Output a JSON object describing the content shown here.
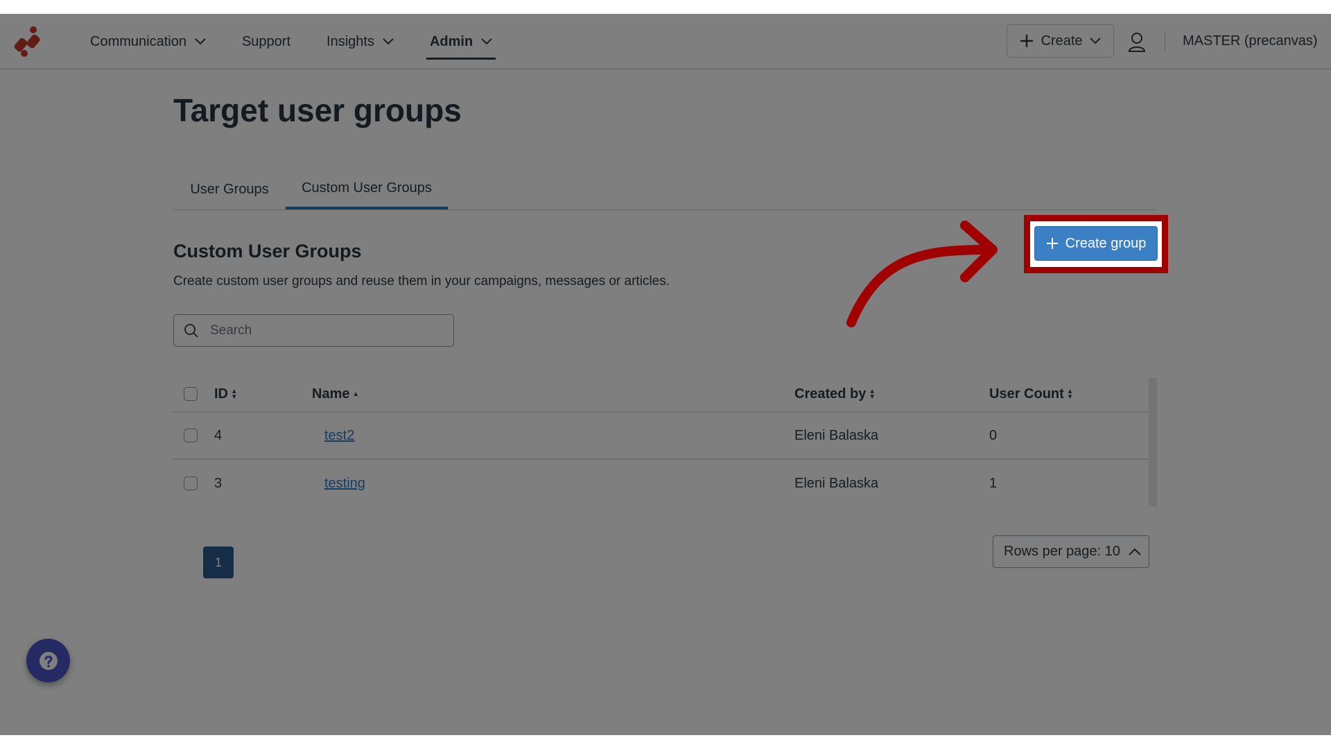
{
  "header": {
    "nav": [
      {
        "label": "Communication",
        "has_dropdown": true,
        "active": false
      },
      {
        "label": "Support",
        "has_dropdown": false,
        "active": false
      },
      {
        "label": "Insights",
        "has_dropdown": true,
        "active": false
      },
      {
        "label": "Admin",
        "has_dropdown": true,
        "active": true
      }
    ],
    "create_label": "Create",
    "account_label": "MASTER (precanvas)",
    "icons": {
      "logo": "brand-logo",
      "user": "user-icon",
      "create": "plus-icon"
    }
  },
  "page": {
    "title": "Target user groups",
    "tabs": [
      {
        "label": "User Groups",
        "active": false
      },
      {
        "label": "Custom User Groups",
        "active": true
      }
    ],
    "section_title": "Custom User Groups",
    "section_description": "Create custom user groups and reuse them in your campaigns, messages or articles.",
    "create_group_label": "Create group",
    "search": {
      "placeholder": "Search",
      "value": ""
    }
  },
  "table": {
    "columns": [
      {
        "label": "ID",
        "sort": "none"
      },
      {
        "label": "Name",
        "sort": "asc"
      },
      {
        "label": "Created by",
        "sort": "none"
      },
      {
        "label": "User Count",
        "sort": "none"
      }
    ],
    "rows": [
      {
        "id": "4",
        "name": "test2",
        "created_by": "Eleni Balaska",
        "user_count": "0"
      },
      {
        "id": "3",
        "name": "testing",
        "created_by": "Eleni Balaska",
        "user_count": "1"
      }
    ]
  },
  "pagination": {
    "current_page": "1",
    "rows_per_page_label": "Rows per page: 10"
  },
  "help": {
    "icon": "question-icon"
  },
  "annotation": {
    "highlight_color": "#a00000",
    "target": "Create group"
  },
  "colors": {
    "primary": "#3b7fc4",
    "page_active": "#2b5b8f",
    "help": "#4a55c5",
    "logo": "#c0392b"
  }
}
